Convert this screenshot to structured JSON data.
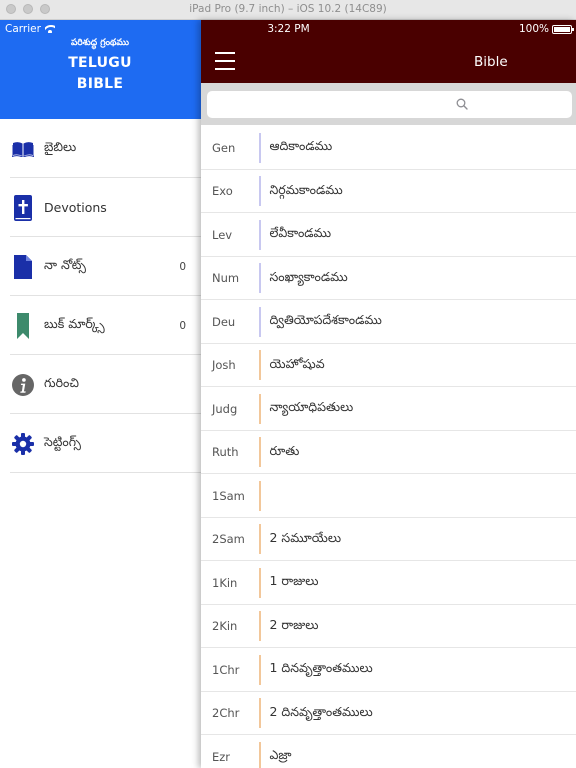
{
  "simulator": {
    "title": "iPad Pro (9.7 inch) – iOS 10.2 (14C89)"
  },
  "status_bar": {
    "carrier": "Carrier",
    "time": "3:22 PM",
    "battery": "100%"
  },
  "drawer": {
    "logo": {
      "subtitle": "పరిశుద్ధ గ్రంథము",
      "line1": "TELUGU",
      "line2": "BIBLE"
    },
    "items": [
      {
        "label": "బైబిలు",
        "count": "",
        "icon": "book-icon"
      },
      {
        "label": "Devotions",
        "count": "",
        "icon": "bible-cross-icon"
      },
      {
        "label": "నా నోట్స్",
        "count": "0",
        "icon": "note-icon"
      },
      {
        "label": "బుక్ మార్క్స్",
        "count": "0",
        "icon": "bookmark-icon"
      },
      {
        "label": "గురించి",
        "count": "",
        "icon": "info-icon"
      },
      {
        "label": "సెట్టింగ్స్",
        "count": "",
        "icon": "gear-icon"
      }
    ]
  },
  "nav": {
    "title": "Bible"
  },
  "search": {
    "placeholder": "",
    "value": ""
  },
  "books": [
    {
      "abbr": "Gen",
      "name": "ఆదికాండము"
    },
    {
      "abbr": "Exo",
      "name": "నిర్గమకాండము"
    },
    {
      "abbr": "Lev",
      "name": "లేవీకాండము"
    },
    {
      "abbr": "Num",
      "name": "సంఖ్యాకాండము"
    },
    {
      "abbr": "Deu",
      "name": "ద్వితియోపదేశకాండము"
    },
    {
      "abbr": "Josh",
      "name": "యెహోషువ"
    },
    {
      "abbr": "Judg",
      "name": "న్యాయాధిపతులు"
    },
    {
      "abbr": "Ruth",
      "name": "రూతు"
    },
    {
      "abbr": "1Sam",
      "name": ""
    },
    {
      "abbr": "2Sam",
      "name": "2 సమూయేలు"
    },
    {
      "abbr": "1Kin",
      "name": "1 రాజులు"
    },
    {
      "abbr": "2Kin",
      "name": "2 రాజులు"
    },
    {
      "abbr": "1Chr",
      "name": "1 దినవృత్తాంతములు"
    },
    {
      "abbr": "2Chr",
      "name": "2 దినవృత్తాంతములు"
    },
    {
      "abbr": "Ezr",
      "name": "ఎజ్రా"
    }
  ],
  "colors": {
    "drawer_header": "#1e6bf2",
    "nav_bar": "#4a0000",
    "icon_blue": "#1a2fa8",
    "icon_green": "#3d8a6c",
    "icon_gray": "#666666",
    "divider_torah": "#c8c8f0",
    "divider_history": "#f2c79a"
  }
}
